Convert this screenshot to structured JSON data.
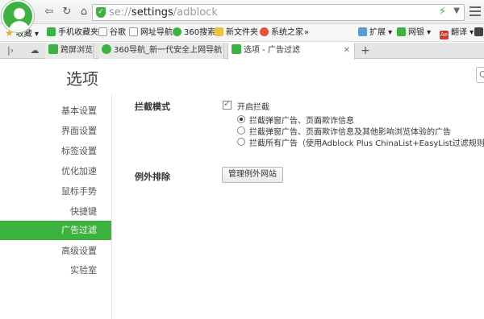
{
  "toolbar": {
    "url_prefix": "se://",
    "url_main": "settings",
    "url_suffix": "/adblock"
  },
  "bookmarks": [
    {
      "label": "收藏",
      "icon": "star-icon"
    },
    {
      "label": "手机收藏夹",
      "icon": "phone-icon"
    },
    {
      "label": "谷歌",
      "icon": "page-icon"
    },
    {
      "label": "网址导航",
      "icon": "page-icon"
    },
    {
      "label": "360搜索",
      "icon": "360-icon"
    },
    {
      "label": "新文件夹",
      "icon": "folder-icon"
    },
    {
      "label": "系统之家",
      "icon": "windows-icon"
    },
    {
      "label": "扩展",
      "icon": "extension-icon"
    },
    {
      "label": "网银",
      "icon": "bank-icon"
    },
    {
      "label": "翻译",
      "icon": "translate-icon"
    }
  ],
  "tabs": [
    {
      "label": "跨屏浏览"
    },
    {
      "label": "360导航_新一代安全上网导航"
    },
    {
      "label": "选项 - 广告过滤"
    }
  ],
  "page": {
    "title": "选项",
    "nav": [
      "基本设置",
      "界面设置",
      "标签设置",
      "优化加速",
      "鼠标手势",
      "快捷键",
      "广告过滤",
      "高级设置",
      "实验室"
    ],
    "active_nav": "广告过滤",
    "block_mode_label": "拦截模式",
    "enable_label": "开启拦截",
    "enable_checked": true,
    "options": [
      "拦截弹窗广告、页面欺诈信息",
      "拦截弹窗广告、页面欺诈信息及其他影响浏览体验的广告",
      "拦截所有广告（使用Adblock Plus ChinaList+EasyList过滤规则）"
    ],
    "selected_option": 0,
    "exceptions_label": "例外排除",
    "manage_button": "管理例外网站"
  },
  "colors": {
    "accent": "#3db33f"
  }
}
